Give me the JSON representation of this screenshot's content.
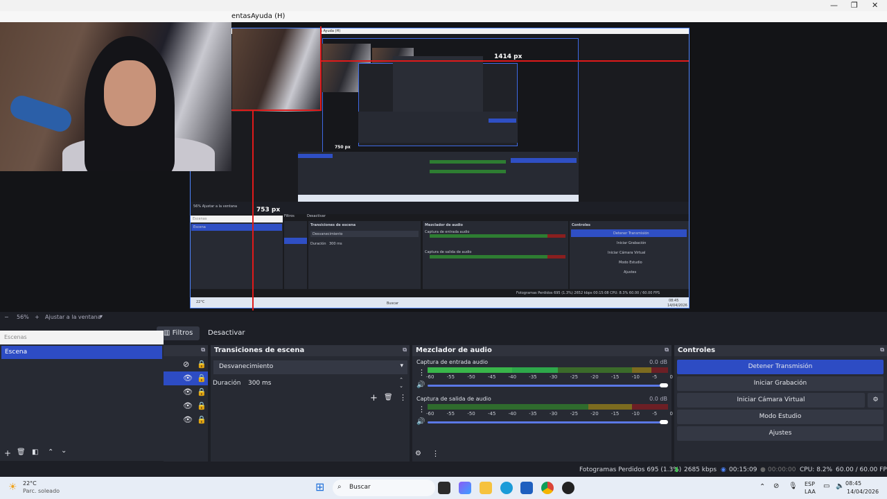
{
  "window": {
    "min": "—",
    "max": "❐",
    "close": "✕"
  },
  "menu": {
    "ventanas": "entas",
    "ayuda": "Ayuda (H)"
  },
  "preview": {
    "nested_menu": "entas   Ayuda (H)",
    "measure_w": "1414 px",
    "measure_h": "753 px",
    "nested_measure": "750 px",
    "nested_zoom": "56%   Ajustar a la ventana",
    "nested_filters": "Filtros",
    "nested_deactivate": "Desactivar",
    "nested_scenes": "Escenas",
    "nested_scene": "Escena",
    "nested_transitions": "Transiciones de escena",
    "nested_fade": "Desvanecimiento",
    "nested_duration": "Duración",
    "nested_ms": "300 ms",
    "nested_mixer": "Mezclador de audio",
    "nested_input": "Captura de entrada audio",
    "nested_output": "Captura de salida de audio",
    "nested_controls": "Controles",
    "nested_stop": "Detener Transmisión",
    "nested_record": "Iniciar Grabación",
    "nested_vcam": "Iniciar Cámara Virtual",
    "nested_studio": "Modo Estudio",
    "nested_settings": "Ajustes",
    "nested_status": "Fotogramas Perdidos 695 (1.3%)   2652 kbps   00:15:08   CPU: 8.3%   60.00 / 60.00 FPS",
    "nested_search": "Buscar",
    "nested_weather": "22°C",
    "nested_time": "08:45",
    "nested_date": "14/04/2026"
  },
  "zoom": {
    "minus": "−",
    "value": "56%",
    "plus": "+",
    "fit": "Ajustar a la ventana"
  },
  "toolbar": {
    "filters": "Filtros",
    "deactivate": "Desactivar"
  },
  "scenes": {
    "title": "Escenas",
    "items": [
      "Escena"
    ]
  },
  "transitions": {
    "title": "Transiciones de escena",
    "selected": "Desvanecimiento",
    "duration_label": "Duración",
    "duration_value": "300 ms"
  },
  "mixer": {
    "title": "Mezclador de audio",
    "channels": [
      {
        "name": "Captura de entrada audio",
        "db": "0.0 dB"
      },
      {
        "name": "Captura de salida de audio",
        "db": "0.0 dB"
      }
    ],
    "scale": "-60 -55 -50 -45 -40 -35 -30 -25 -20 -15 -10 -5 0"
  },
  "controls": {
    "title": "Controles",
    "stop_stream": "Detener Transmisión",
    "start_record": "Iniciar Grabación",
    "start_vcam": "Iniciar Cámara Virtual",
    "studio_mode": "Modo Estudio",
    "settings": "Ajustes"
  },
  "status": {
    "dropped": "Fotogramas Perdidos 695 (1.3%)",
    "bitrate": "2685 kbps",
    "stream_time": "00:15:09",
    "record_time": "00:00:00",
    "cpu": "CPU: 8.2%",
    "fps": "60.00 / 60.00 FPS"
  },
  "taskbar": {
    "weather_temp": "22°C",
    "weather_desc": "Parc. soleado",
    "search": "Buscar",
    "lang": "ESP",
    "lang2": "LAA",
    "time": "08:45",
    "date": "14/04/2026"
  },
  "colors": {
    "accent": "#2d4cc4",
    "panel": "#272a33",
    "live_red": "#e01a1a"
  }
}
